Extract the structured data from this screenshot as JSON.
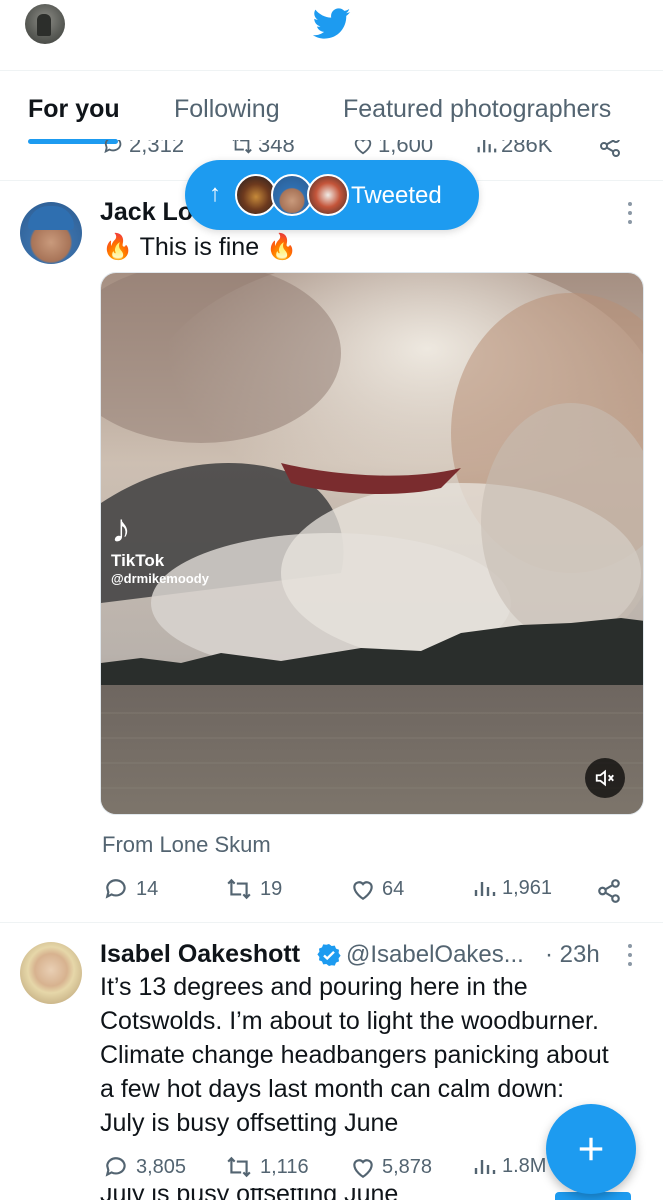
{
  "header": {
    "logo_icon": "twitter-bird-icon",
    "accent": "#1d9bf0"
  },
  "tabs": [
    {
      "label": "For you",
      "active": true
    },
    {
      "label": "Following",
      "active": false
    },
    {
      "label": "Featured photographers",
      "active": false
    }
  ],
  "previous_tweet": {
    "replies": "2,312",
    "retweets": "348",
    "likes": "1,600",
    "views": "286K"
  },
  "new_tweets_pill": {
    "label": "Tweeted",
    "arrow": "↑"
  },
  "tweet1": {
    "name": "Jack Lo",
    "text": "🔥 This is fine 🔥",
    "media": {
      "watermark_brand": "TikTok",
      "watermark_user": "@drmikemoody",
      "mute_icon": "mute-icon"
    },
    "source": "From Lone Skum",
    "replies": "14",
    "retweets": "19",
    "likes": "64",
    "views": "1,961"
  },
  "tweet2": {
    "name": "Isabel Oakeshott",
    "verified": true,
    "handle": "@IsabelOakes...",
    "time": "· 23h",
    "text_lines": [
      "It’s 13 degrees and pouring here in the",
      "Cotswolds. I’m about to light the woodburner.",
      "Climate change headbangers panicking about",
      "a few hot days last month can calm down:",
      "July is busy offsetting June"
    ],
    "replies": "3,805",
    "retweets": "1,116",
    "likes": "5,878",
    "views": "1.8M",
    "peek_text": "July is busy offsetting June"
  },
  "fab": {
    "icon": "compose-plus-icon"
  }
}
